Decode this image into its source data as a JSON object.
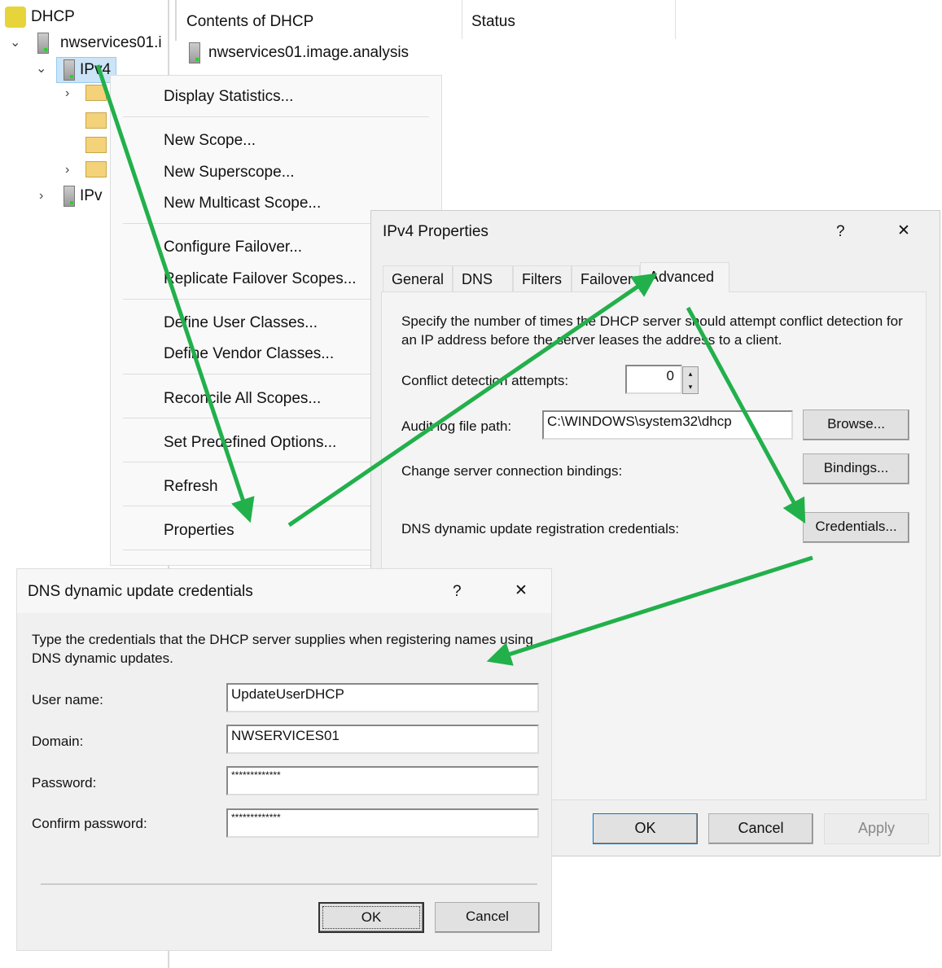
{
  "tree": {
    "root": "DHCP",
    "server": "nwservices01.i",
    "ipv4": "IPv4",
    "ipv6": "IPv"
  },
  "content": {
    "header": "Contents of DHCP",
    "status_header": "Status",
    "item": "nwservices01.image.analysis"
  },
  "context_menu": {
    "items": [
      "Display Statistics...",
      "New Scope...",
      "New Superscope...",
      "New Multicast Scope...",
      "Configure Failover...",
      "Replicate Failover Scopes...",
      "Define User Classes...",
      "Define Vendor Classes...",
      "Reconcile All Scopes...",
      "Set Predefined Options...",
      "Refresh",
      "Properties"
    ]
  },
  "props": {
    "title": "IPv4 Properties",
    "help": "?",
    "close": "✕",
    "tabs": [
      "General",
      "DNS",
      "Filters",
      "Failover",
      "Advanced"
    ],
    "active_tab": "Advanced",
    "desc": "Specify the number of times the DHCP server should attempt conflict detection for an IP address before the server leases the address to a client.",
    "conflict_label": "Conflict detection attempts:",
    "conflict_value": "0",
    "audit_label": "Audit log file path:",
    "audit_value": "C:\\WINDOWS\\system32\\dhcp",
    "browse": "Browse...",
    "bindings_label": "Change server connection bindings:",
    "bindings": "Bindings...",
    "cred_label": "DNS dynamic update registration credentials:",
    "credentials": "Credentials...",
    "ok": "OK",
    "cancel": "Cancel",
    "apply": "Apply"
  },
  "cred": {
    "title": "DNS dynamic update credentials",
    "help": "?",
    "close": "✕",
    "desc": "Type the credentials that the DHCP server supplies when registering names using DNS dynamic updates.",
    "user_label": "User name:",
    "user": "UpdateUserDHCP",
    "domain_label": "Domain:",
    "domain": "NWSERVICES01",
    "password_label": "Password:",
    "password": "*************",
    "confirm_label": "Confirm password:",
    "confirm": "*************",
    "ok": "OK",
    "cancel": "Cancel"
  },
  "colors": {
    "arrow": "#22b04b"
  }
}
